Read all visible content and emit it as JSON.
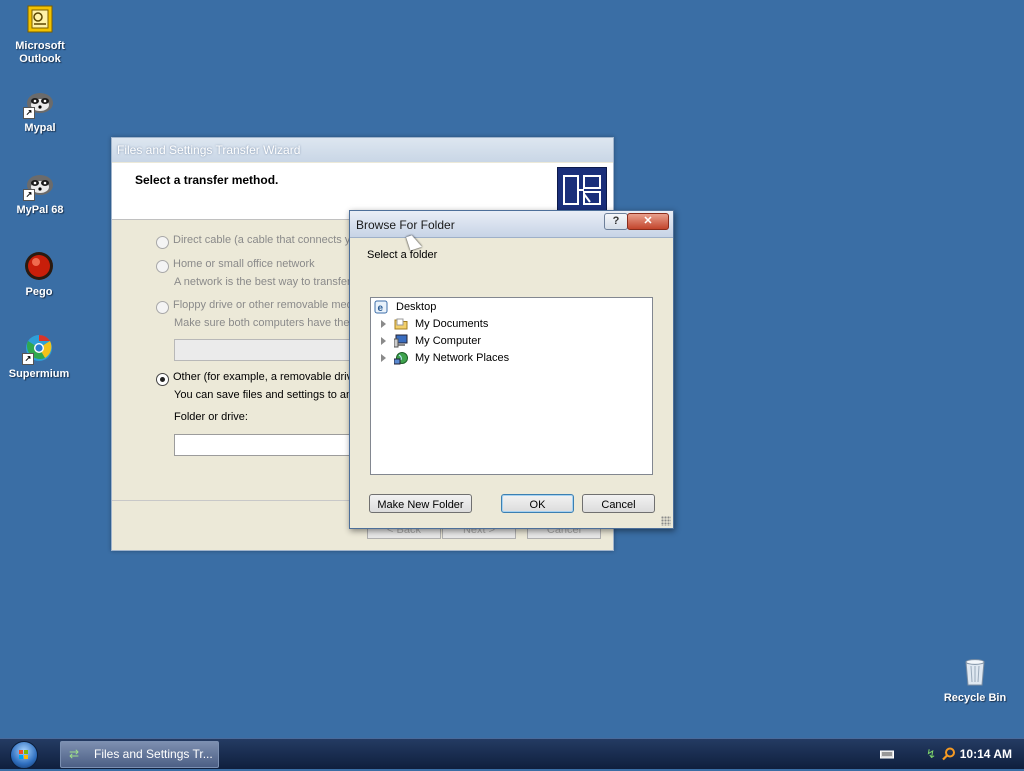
{
  "desktop": {
    "icons": [
      {
        "label": "Microsoft Outlook",
        "icon": "outlook-icon"
      },
      {
        "label": "Mypal",
        "icon": "raccoon-icon"
      },
      {
        "label": "MyPal 68",
        "icon": "raccoon-icon"
      },
      {
        "label": "Pego",
        "icon": "red-orb-icon"
      },
      {
        "label": "Supermium",
        "icon": "globe-icon"
      },
      {
        "label": "Recycle Bin",
        "icon": "recycle-bin-icon"
      }
    ]
  },
  "wizard": {
    "title": "Files and Settings Transfer Wizard",
    "header_title": "Select a transfer method.",
    "options": [
      {
        "label": "Direct cable (a cable that connects y",
        "selected": false
      },
      {
        "label": "Home or small office network",
        "description": "A network is the best way to transfer",
        "selected": false
      },
      {
        "label": "Floppy drive or other removable media",
        "description": "Make sure both computers have the",
        "selected": false
      },
      {
        "label": "Other (for example, a removable drive",
        "description": "You can save files and settings to an",
        "selected": true
      }
    ],
    "folder_label": "Folder or drive:",
    "buttons": [
      "< Back",
      "Next >",
      "Cancel"
    ]
  },
  "browse_dialog": {
    "title": "Browse For Folder",
    "help_button": "?",
    "close_button": "✕",
    "prompt": "Select a folder",
    "tree": [
      {
        "label": "Desktop",
        "icon": "desktop-icon",
        "level": 0,
        "expandable": false
      },
      {
        "label": "My Documents",
        "icon": "folder-icon",
        "level": 1,
        "expandable": true
      },
      {
        "label": "My Computer",
        "icon": "computer-icon",
        "level": 1,
        "expandable": true
      },
      {
        "label": "My Network Places",
        "icon": "network-places-icon",
        "level": 1,
        "expandable": true
      }
    ],
    "make_new_folder": "Make New Folder",
    "ok": "OK",
    "cancel": "Cancel"
  },
  "taskbar": {
    "task_label": "Files and Settings Tr...",
    "clock": "10:14 AM",
    "tray_icons": [
      "keyboard-icon",
      "network-icon",
      "search-icon"
    ]
  },
  "colors": {
    "desktop_bg": "#3a6ea5",
    "taskbar_bg": "#1a2d52",
    "close_button": "#c2452c"
  }
}
